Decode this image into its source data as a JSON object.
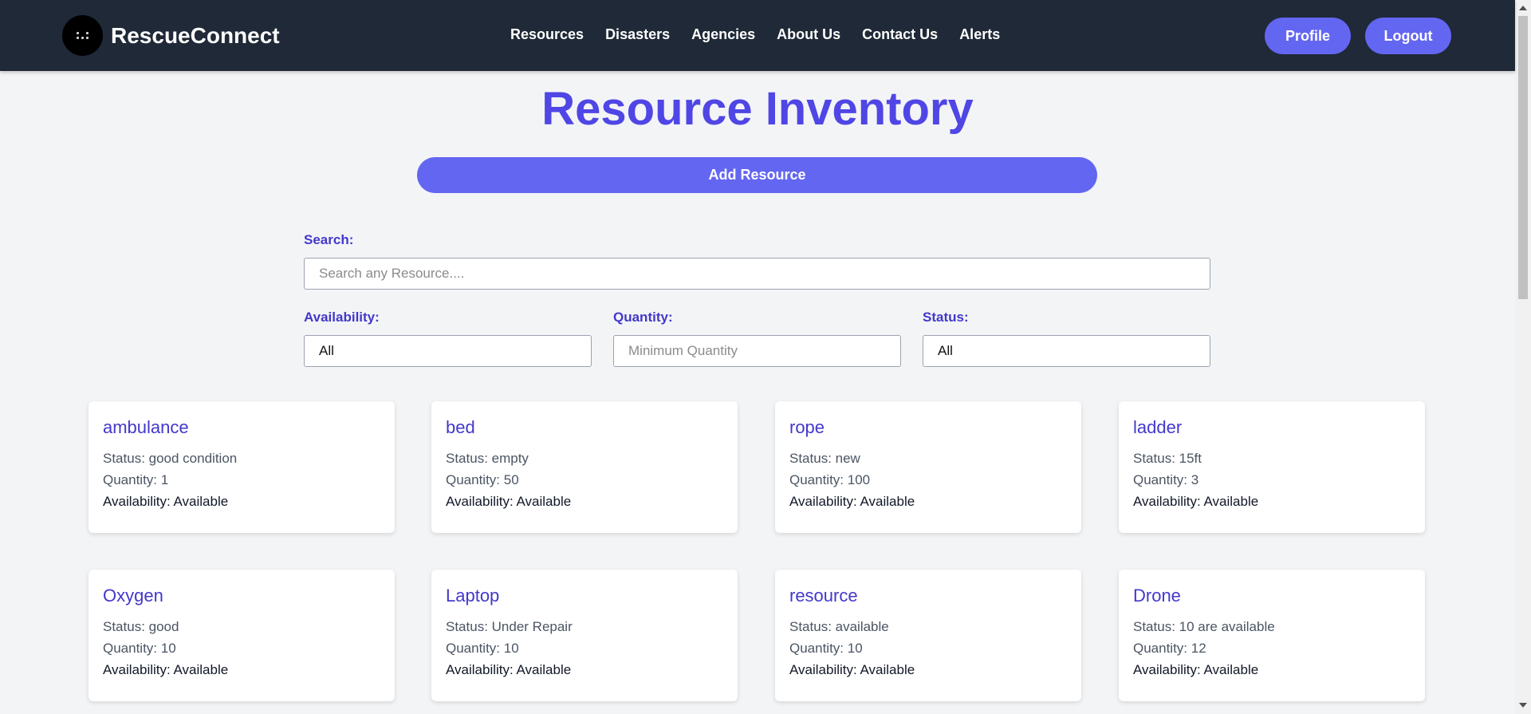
{
  "app": {
    "name": "RescueConnect"
  },
  "nav": {
    "links": [
      "Resources",
      "Disasters",
      "Agencies",
      "About Us",
      "Contact Us",
      "Alerts"
    ],
    "profile_label": "Profile",
    "logout_label": "Logout"
  },
  "page": {
    "title": "Resource Inventory",
    "add_button_label": "Add Resource"
  },
  "filters": {
    "search_label": "Search:",
    "search_placeholder": "Search any Resource....",
    "availability_label": "Availability:",
    "availability_value": "All",
    "quantity_label": "Quantity:",
    "quantity_placeholder": "Minimum Quantity",
    "status_label": "Status:",
    "status_value": "All"
  },
  "resources": [
    {
      "name": "ambulance",
      "status": "Status: good condition",
      "quantity": "Quantity: 1",
      "availability": "Availability: Available"
    },
    {
      "name": "bed",
      "status": "Status: empty",
      "quantity": "Quantity: 50",
      "availability": "Availability: Available"
    },
    {
      "name": "rope",
      "status": "Status: new",
      "quantity": "Quantity: 100",
      "availability": "Availability: Available"
    },
    {
      "name": "ladder",
      "status": "Status: 15ft",
      "quantity": "Quantity: 3",
      "availability": "Availability: Available"
    },
    {
      "name": "Oxygen",
      "status": "Status: good",
      "quantity": "Quantity: 10",
      "availability": "Availability: Available"
    },
    {
      "name": "Laptop",
      "status": "Status: Under Repair",
      "quantity": "Quantity: 10",
      "availability": "Availability: Available"
    },
    {
      "name": "resource",
      "status": "Status: available",
      "quantity": "Quantity: 10",
      "availability": "Availability: Available"
    },
    {
      "name": "Drone",
      "status": "Status: 10 are available",
      "quantity": "Quantity: 12",
      "availability": "Availability: Available"
    }
  ],
  "colors": {
    "nav_bg": "#1f2937",
    "accent": "#6366f1",
    "title": "#4f46e5",
    "label": "#4338ca",
    "page_bg": "#f3f4f6"
  }
}
